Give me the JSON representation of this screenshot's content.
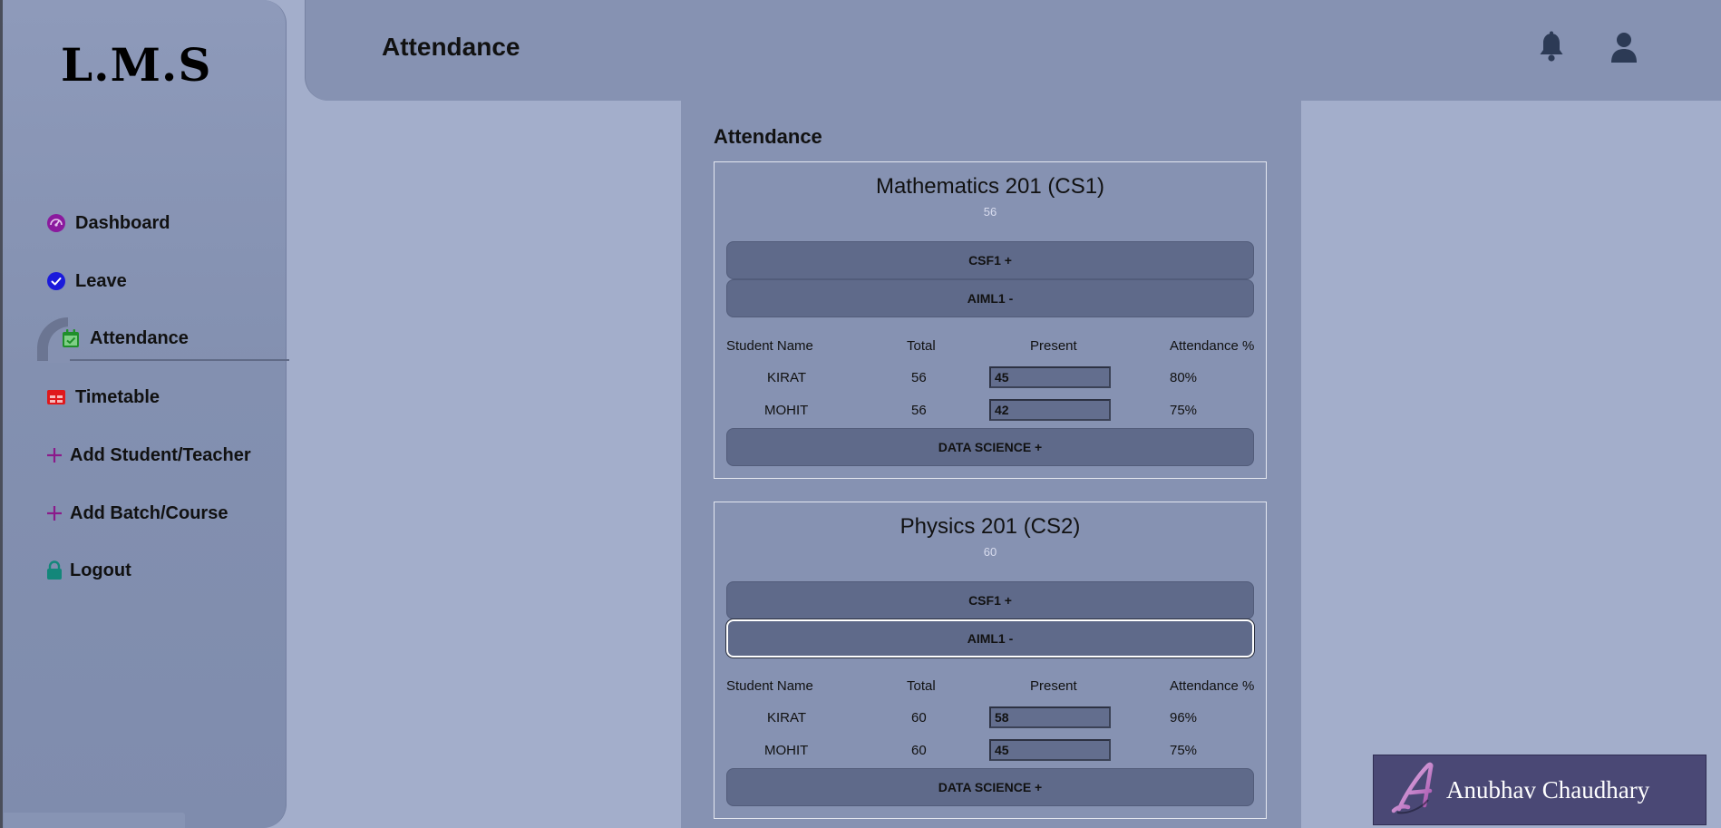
{
  "sidebar": {
    "logo": "L.M.S",
    "items": [
      {
        "label": "Dashboard"
      },
      {
        "label": "Leave"
      },
      {
        "label": "Attendance"
      },
      {
        "label": "Timetable"
      },
      {
        "label": "Add Student/Teacher"
      },
      {
        "label": "Add Batch/Course"
      },
      {
        "label": "Logout"
      }
    ],
    "active": "Attendance"
  },
  "header": {
    "title": "Attendance",
    "icons": [
      "bell-icon",
      "user-icon"
    ]
  },
  "main": {
    "title": "Attendance",
    "table_headers": [
      "Student Name",
      "Total",
      "Present",
      "Attendance %"
    ],
    "courses": [
      {
        "name": "Mathematics 201 (CS1)",
        "total": "56",
        "batches_top": [
          "CSF1 +",
          "AIML1 -"
        ],
        "rows": [
          {
            "name": "KIRAT",
            "total": "56",
            "present": "45",
            "percent": "80%"
          },
          {
            "name": "MOHIT",
            "total": "56",
            "present": "42",
            "percent": "75%"
          }
        ],
        "batch_bottom": "DATA SCIENCE +"
      },
      {
        "name": "Physics 201 (CS2)",
        "total": "60",
        "batches_top": [
          "CSF1 +",
          "AIML1 -"
        ],
        "rows": [
          {
            "name": "KIRAT",
            "total": "60",
            "present": "58",
            "percent": "96%"
          },
          {
            "name": "MOHIT",
            "total": "60",
            "present": "45",
            "percent": "75%"
          }
        ],
        "batch_bottom": "DATA SCIENCE +"
      }
    ]
  },
  "signature": {
    "name": "Anubhav Chaudhary"
  },
  "colors": {
    "background": "#a3aecb",
    "sidebar": "#8692b2",
    "button": "#5f6a8a",
    "dashboard_icon": "#8b1a9e",
    "leave_icon": "#1a1adb",
    "attendance_icon": "#1f8f2a",
    "timetable_icon": "#e0181b",
    "add_icon": "#8b1a8b",
    "logout_icon": "#13877a",
    "header_icon": "#2c3a55",
    "signature_bg": "#4a4875"
  }
}
